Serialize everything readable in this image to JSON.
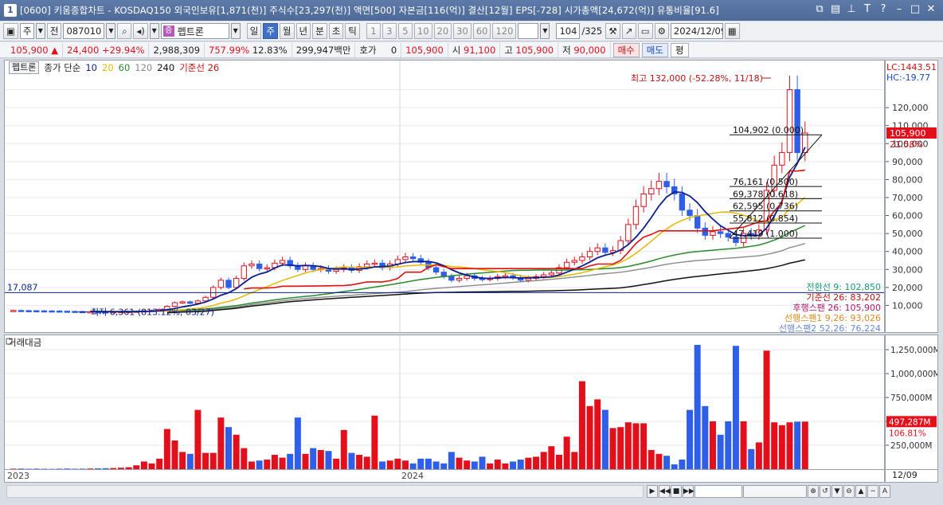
{
  "window": {
    "number": "1",
    "title": "[0600] 키움종합차트 - KOSDAQ150 외국인보유[1,871(천)] 주식수[23,297(천)] 액면[500] 자본금[116(억)] 결산[12월] EPS[-728] 시가총액[24,672(억)] 유통비율[91.6]",
    "icons": [
      "restore-icon",
      "split-icon",
      "pin-icon",
      "text-icon",
      "help-icon",
      "minimize-icon",
      "maximize-icon",
      "close-icon"
    ]
  },
  "toolbar": {
    "period_unit": "주",
    "prev_label": "전",
    "code": "087010",
    "stock_name": "펩트론",
    "name_badge": "증",
    "periods": [
      "일",
      "주",
      "월",
      "년",
      "분",
      "초",
      "틱"
    ],
    "selected_period": "주",
    "intervals": [
      "1",
      "3",
      "5",
      "10",
      "20",
      "30",
      "60",
      "120"
    ],
    "count": "104",
    "count_total": "/325",
    "date": "2024/12/09"
  },
  "quote": {
    "price": "105,900",
    "change": "24,400",
    "change_rate": "+29.94%",
    "volume": "2,988,309",
    "volume_rate": "757.99%",
    "turnover": "12.83%",
    "amount": "299,947백만",
    "hoga_label": "호가",
    "hoga_value": "0",
    "hoga_price": "105,900",
    "open_label": "시",
    "open": "91,100",
    "high_label": "고",
    "high": "105,900",
    "low_label": "저",
    "low": "90,000",
    "buy_label": "매수",
    "sell_label": "매도",
    "eval_label": "평"
  },
  "price_pane": {
    "tag": "펩트론",
    "legend_prefix": "종가 단순",
    "legend_ma": [
      {
        "label": "10",
        "color": "#0a1f8f"
      },
      {
        "label": "20",
        "color": "#e8b800"
      },
      {
        "label": "60",
        "color": "#2a8a2a"
      },
      {
        "label": "120",
        "color": "#8a8a8a"
      },
      {
        "label": "240",
        "color": "#111111"
      }
    ],
    "legend_base": "기준선 26",
    "lc": "LC:1443.51",
    "hc": "HC:-19.77",
    "y_ticks": [
      "120,000",
      "110,000",
      "100,000",
      "90,000",
      "80,000",
      "70,000",
      "60,000",
      "50,000",
      "40,000",
      "30,000",
      "20,000",
      "10,000"
    ],
    "current_price_tag": "105,900",
    "current_pct_tag": "21.58%",
    "high_note": "최고 132,000 (-52.28%, 11/18)",
    "low_note": "최저 6,361 (813.12%, 03/27)",
    "hline_label": "17,087",
    "fib_levels": [
      "104,902 (0.000)",
      "76,161 (0.500)",
      "69,378 (0.618)",
      "62,595 (0.736)",
      "55,812 (0.854)",
      "47,419 (1.000)"
    ],
    "ichimoku_notes": [
      {
        "text": "전환선 9: 102,850",
        "color": "#1a9a7a"
      },
      {
        "text": "기준선 26: 83,202",
        "color": "#c01010"
      },
      {
        "text": "후행스팬 26: 105,900",
        "color": "#b01a6a"
      },
      {
        "text": "선행스팬1 9,26: 93,026",
        "color": "#e08a20"
      },
      {
        "text": "선행스팬2 52,26: 76,224",
        "color": "#6a8ad0"
      }
    ]
  },
  "volume_pane": {
    "title": "거래대금",
    "y_ticks": [
      "1,250,000M",
      "1,000,000M",
      "750,000M",
      "500,000M",
      "250,000M"
    ],
    "current_tag": "497,287M",
    "current_pct": "106.81%"
  },
  "x_axis": {
    "labels": [
      "2023",
      "2024"
    ],
    "end_label": "12/09"
  },
  "colors": {
    "up": "#e3101c",
    "down": "#2f5fe8",
    "bg": "#ffffff",
    "grid": "#e6e9ee"
  },
  "chart_data": {
    "type": "candlestick-weekly",
    "weeks": 104,
    "closes": [
      7200,
      7100,
      7050,
      7000,
      6950,
      6900,
      6800,
      6700,
      6600,
      6500,
      6500,
      6400,
      6361,
      6500,
      6600,
      6700,
      6800,
      7000,
      7200,
      7800,
      9500,
      11500,
      12000,
      11200,
      12500,
      14500,
      20000,
      24000,
      20000,
      25000,
      32000,
      33000,
      30500,
      31000,
      33500,
      35000,
      32000,
      30000,
      32000,
      30000,
      30500,
      29000,
      30000,
      31000,
      29500,
      31500,
      33000,
      33500,
      31000,
      33000,
      35500,
      37000,
      36000,
      34000,
      31000,
      28500,
      26000,
      24000,
      25000,
      26500,
      25000,
      24500,
      25000,
      26000,
      26500,
      25500,
      24000,
      25000,
      26000,
      27000,
      28000,
      31000,
      34000,
      35000,
      37000,
      40000,
      42000,
      39500,
      40500,
      46000,
      55000,
      65000,
      72000,
      75000,
      79000,
      76000,
      72000,
      63000,
      60000,
      53000,
      49000,
      51000,
      50000,
      48000,
      45000,
      50000,
      49000,
      52000,
      74000,
      88000,
      95000,
      130000,
      95000,
      105900
    ],
    "volume_amounts_mln": [
      5000,
      6000,
      4000,
      5000,
      4000,
      3000,
      5000,
      6000,
      4000,
      5000,
      7000,
      8000,
      10000,
      12000,
      15000,
      20000,
      40000,
      80000,
      60000,
      110000,
      420000,
      300000,
      180000,
      160000,
      620000,
      170000,
      170000,
      540000,
      440000,
      360000,
      220000,
      80000,
      90000,
      100000,
      150000,
      120000,
      160000,
      540000,
      160000,
      220000,
      200000,
      190000,
      110000,
      410000,
      170000,
      150000,
      130000,
      560000,
      80000,
      90000,
      110000,
      90000,
      60000,
      110000,
      110000,
      80000,
      60000,
      180000,
      120000,
      90000,
      80000,
      130000,
      60000,
      100000,
      60000,
      80000,
      100000,
      120000,
      130000,
      180000,
      240000,
      150000,
      340000,
      180000,
      920000,
      660000,
      730000,
      620000,
      430000,
      440000,
      490000,
      480000,
      480000,
      200000,
      160000,
      140000,
      50000,
      100000,
      620000,
      1300000,
      660000,
      500000,
      360000,
      500000,
      1290000,
      500000,
      210000,
      280000,
      1240000,
      490000,
      460000,
      490000,
      497287,
      497287
    ],
    "price_ylim": [
      0,
      140000
    ],
    "volume_ylim": [
      0,
      1350000
    ]
  }
}
